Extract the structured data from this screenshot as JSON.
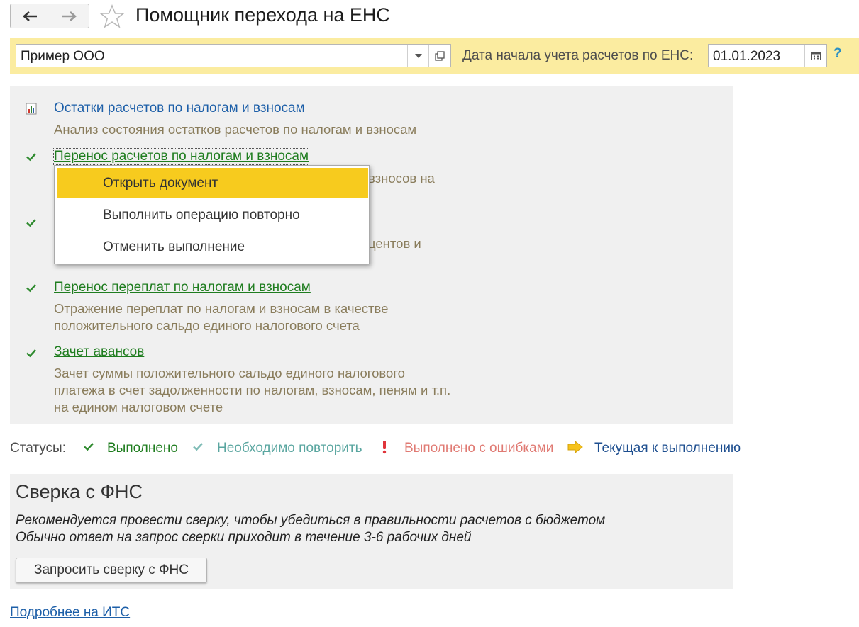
{
  "header": {
    "back_icon": "arrow-left-icon",
    "forward_icon": "arrow-right-icon",
    "favorite_icon": "star-icon",
    "title": "Помощник перехода на ЕНС"
  },
  "toolbar": {
    "organization": "Пример ООО",
    "date_label": "Дата начала учета расчетов по ЕНС:",
    "date_value": "01.01.2023",
    "help": "?"
  },
  "steps": [
    {
      "icon": "report-chart-icon",
      "link": "Остатки расчетов по налогам и взносам",
      "desc": [
        "Анализ состояния остатков расчетов по налогам и взносам"
      ]
    },
    {
      "icon": "check-icon",
      "link": "Перенос расчетов по налогам и взносам",
      "desc": [
        "взносов на"
      ]
    },
    {
      "icon": "check-icon",
      "desc": [
        "центов и"
      ]
    },
    {
      "icon": "check-icon",
      "link": "Перенос переплат по налогам и взносам",
      "desc": [
        "Отражение переплат по налогам и взносам в качестве",
        "положительного сальдо единого налогового счета"
      ]
    },
    {
      "icon": "check-icon",
      "link": "Зачет авансов",
      "desc": [
        "Зачет суммы положительного сальдо единого налогового",
        "платежа в счет задолженности по налогам, взносам, пеням и т.п.",
        "на едином налоговом счете"
      ]
    }
  ],
  "context_menu": {
    "items": [
      "Открыть документ",
      "Выполнить операцию повторно",
      "Отменить выполнение"
    ],
    "active_index": 0
  },
  "statuses": {
    "label": "Статусы:",
    "items": [
      {
        "icon": "check-icon",
        "text": "Выполнено",
        "color": "#1f7d1f"
      },
      {
        "icon": "check-light-icon",
        "text": "Необходимо повторить",
        "color": "#5aa6a0"
      },
      {
        "icon": "exclamation-icon",
        "text": "Выполнено с ошибками",
        "color": "#e07a73"
      },
      {
        "icon": "arrow-right-yellow-icon",
        "text": "Текущая к выполнению",
        "color": "#1d4e8f"
      }
    ]
  },
  "reconciliation": {
    "title": "Сверка с ФНС",
    "line1": "Рекомендуется провести сверку, чтобы убедиться в правильности расчетов с бюджетом",
    "line2": "Обычно ответ на запрос сверки приходит в течение 3-6 рабочих дней",
    "button": "Запросить сверку с ФНС"
  },
  "footer": {
    "link": "Подробнее на ИТС"
  },
  "colors": {
    "toolbar_bg": "#fbeca0",
    "menu_highlight": "#f7cb1e",
    "panel_bg": "#f0f0f0",
    "link_blue": "#1d5fa8",
    "link_green": "#1f7d1f"
  }
}
